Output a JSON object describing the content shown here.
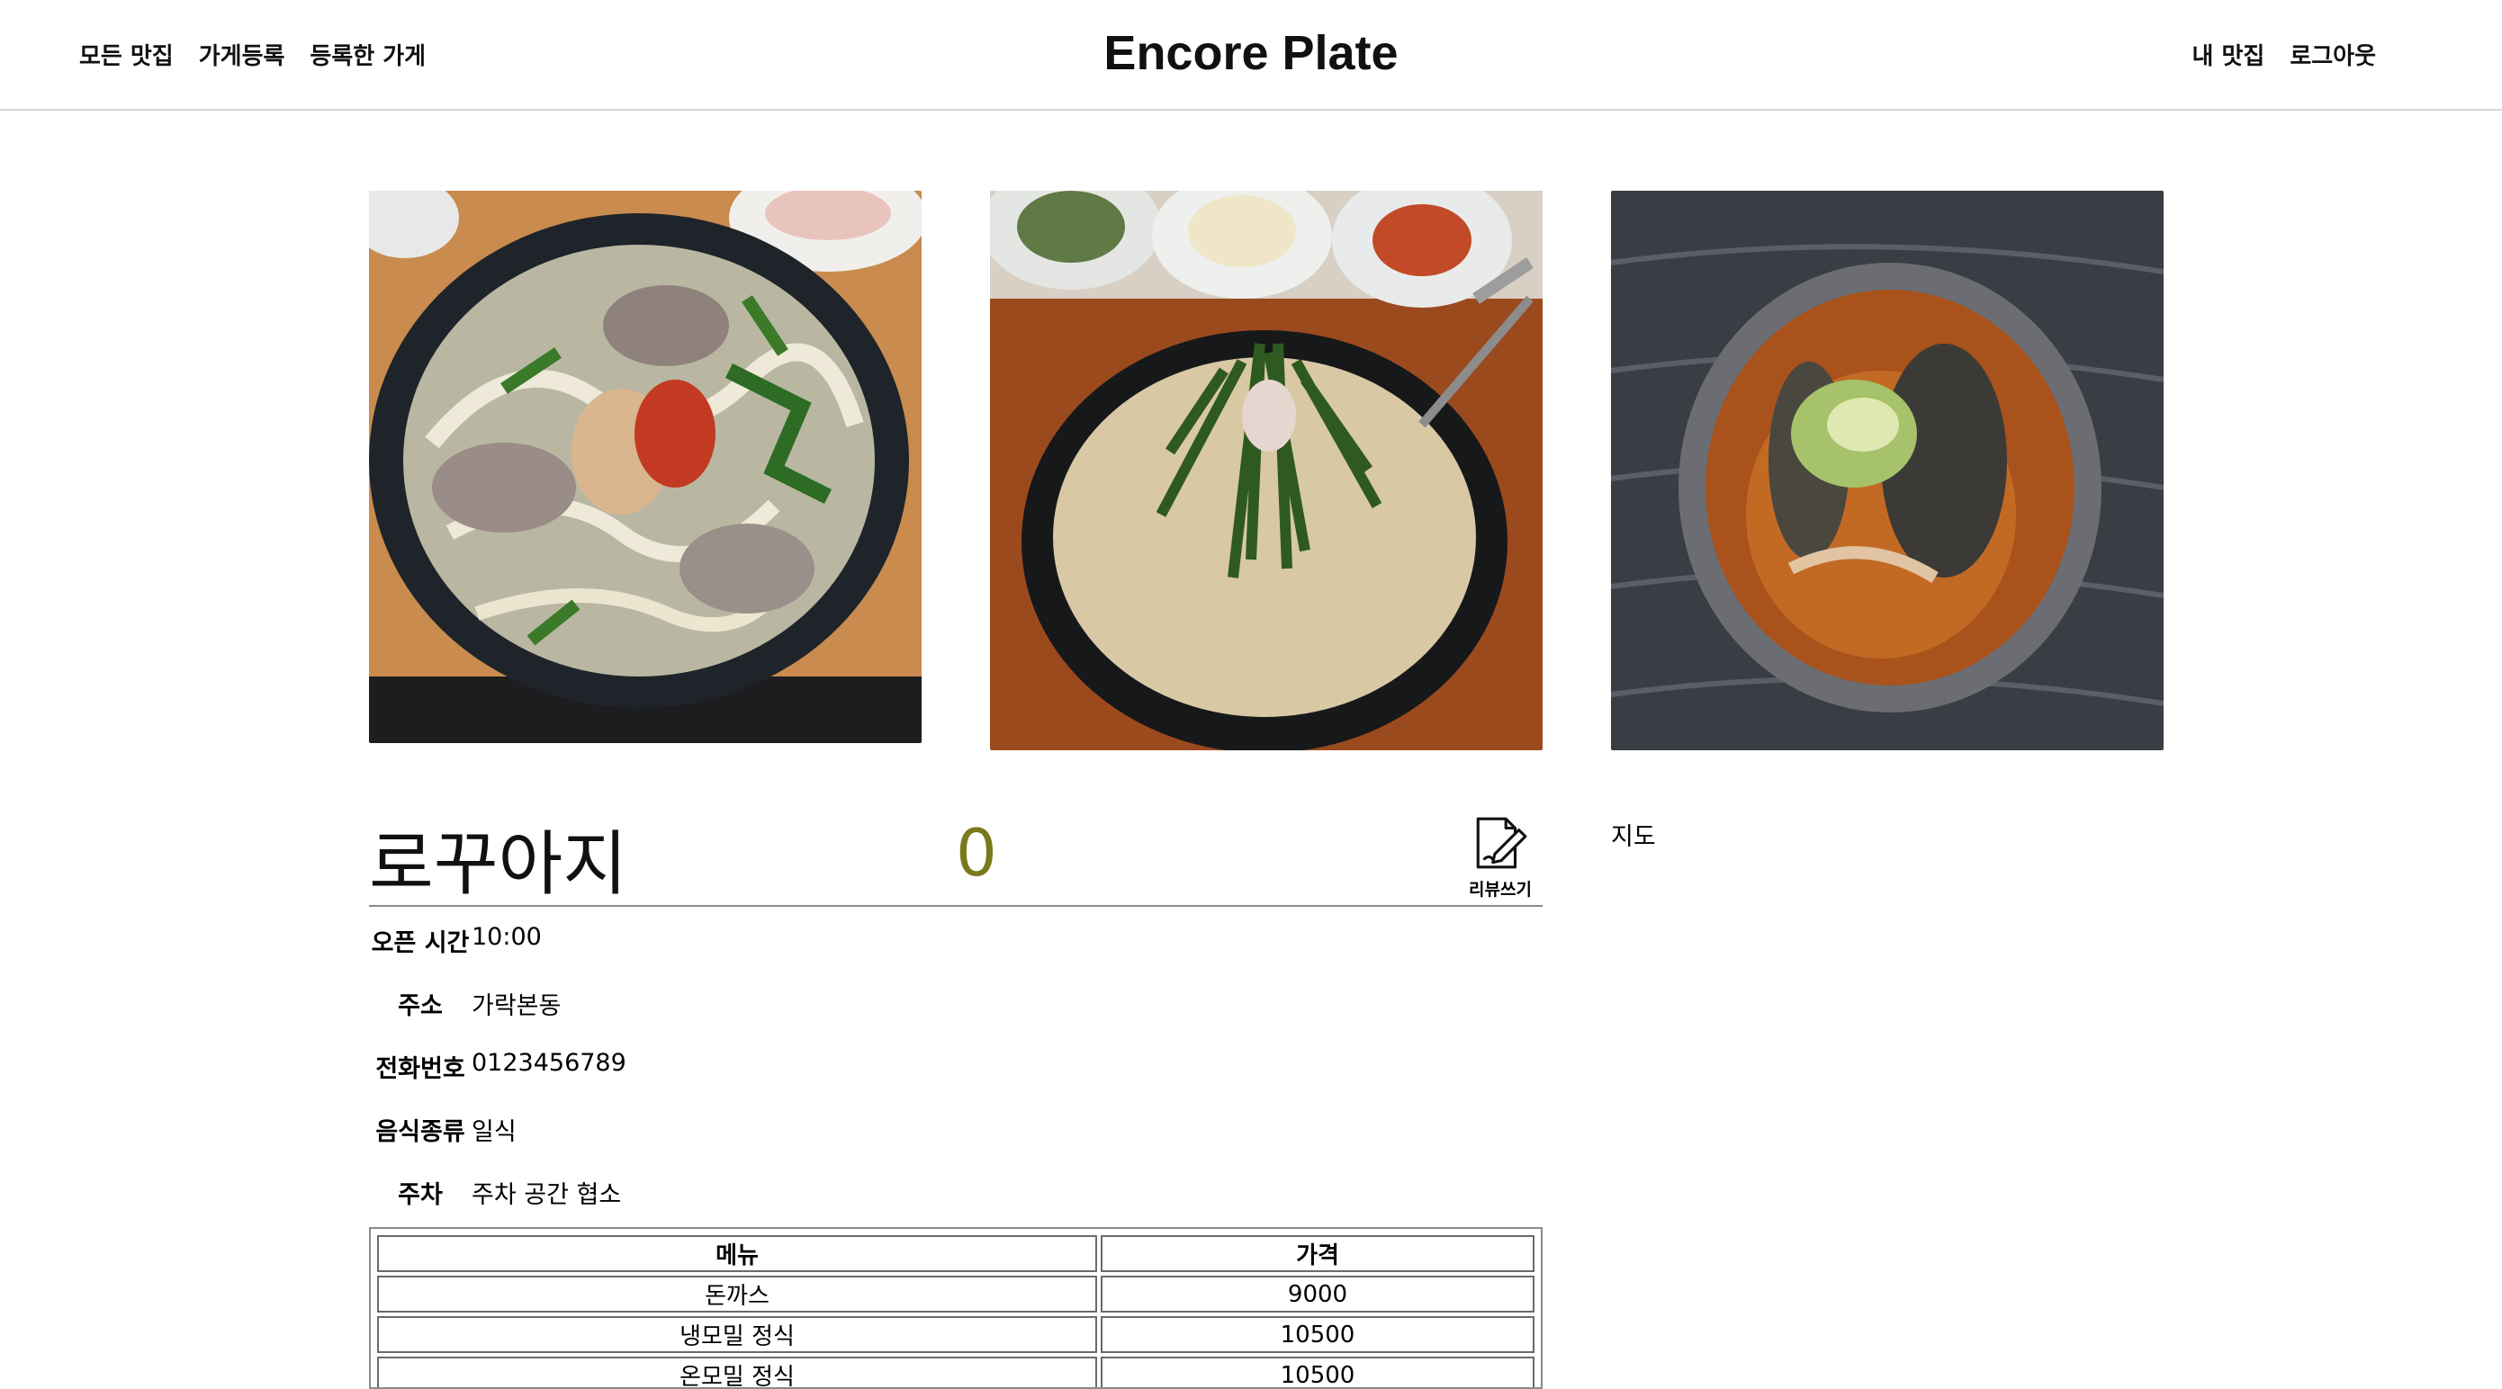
{
  "header": {
    "brand": "Encore Plate",
    "nav_left": [
      "모든 맛집",
      "가게등록",
      "등록한 가게"
    ],
    "nav_right": [
      "내 맛집",
      "로그아웃"
    ]
  },
  "photos": [
    {
      "subject": "돼지국밥 with noodles",
      "icon": "food-photo"
    },
    {
      "subject": "순대국밥 with chives",
      "icon": "food-photo"
    },
    {
      "subject": "spicy fish stew",
      "icon": "food-photo"
    }
  ],
  "store": {
    "name": "로꾸아지",
    "rating": "0",
    "review_button_label": "리뷰쓰기",
    "map_label": "지도",
    "info": [
      {
        "label": "오픈 시간",
        "value": "10:00"
      },
      {
        "label": "주소",
        "value": "가락본동"
      },
      {
        "label": "전화번호",
        "value": "0123456789"
      },
      {
        "label": "음식종류",
        "value": "일식"
      },
      {
        "label": "주차",
        "value": "주차 공간 협소"
      }
    ]
  },
  "menu_table": {
    "headers": [
      "메뉴",
      "가격"
    ],
    "rows": [
      [
        "돈까스",
        "9000"
      ],
      [
        "냉모밀 정식",
        "10500"
      ],
      [
        "온모밀 정식",
        "10500"
      ]
    ]
  },
  "colors": {
    "rating": "#7a7a1c",
    "divider": "#d6d6d6"
  }
}
